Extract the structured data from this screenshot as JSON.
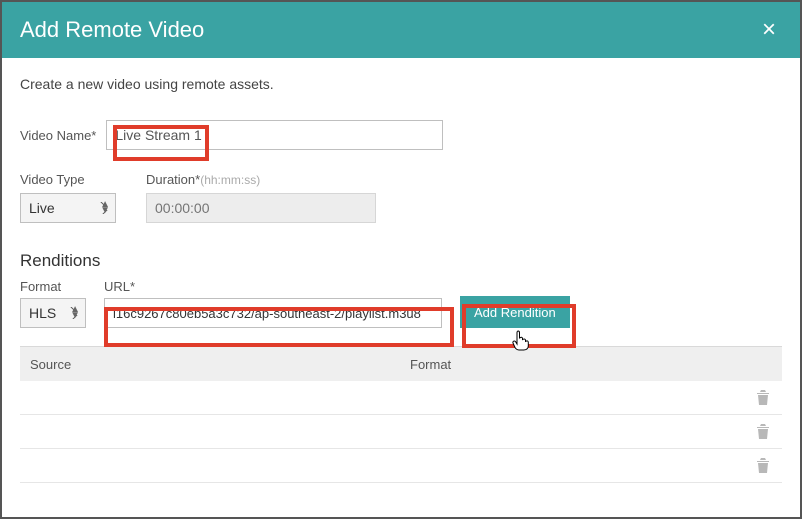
{
  "header": {
    "title": "Add Remote Video"
  },
  "intro": "Create a new video using remote assets.",
  "fields": {
    "video_name_label": "Video Name*",
    "video_name_value": "Live Stream 1",
    "video_type_label": "Video Type",
    "video_type_value": "Live",
    "duration_label": "Duration*",
    "duration_hint": "(hh:mm:ss)",
    "duration_placeholder": "00:00:00"
  },
  "renditions": {
    "heading": "Renditions",
    "format_label": "Format",
    "format_value": "HLS",
    "url_label": "URL*",
    "url_value": "l16c9267c80eb5a3c732/ap-southeast-2/playlist.m3u8",
    "add_button": "Add Rendition",
    "columns": {
      "source": "Source",
      "format": "Format"
    }
  },
  "icons": {
    "close": "×"
  }
}
